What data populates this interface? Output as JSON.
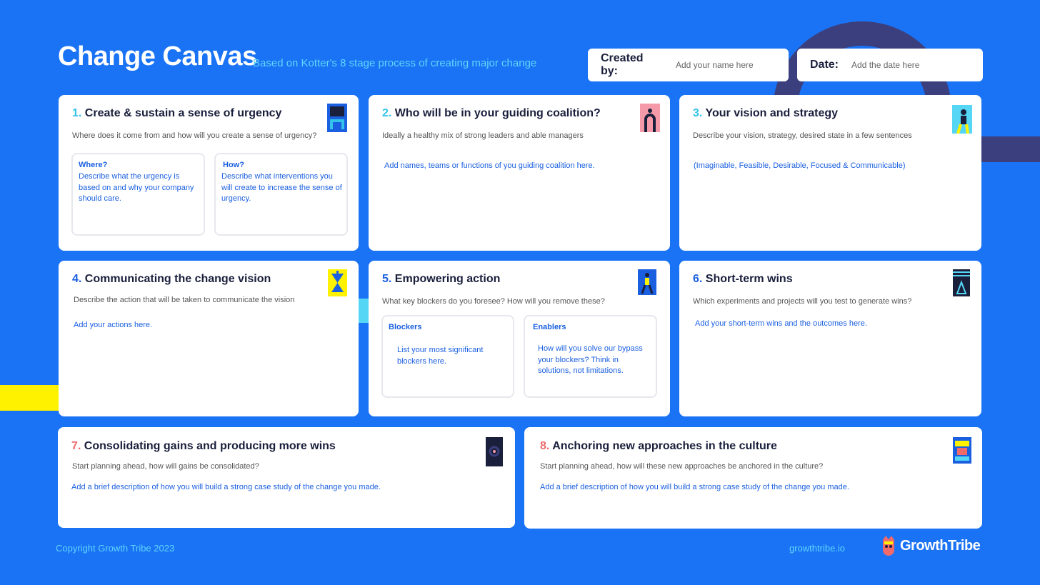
{
  "header": {
    "title": "Change Canvas",
    "subtitle": "Based on Kotter's 8 stage process of creating major change",
    "created_by_label": "Created by:",
    "created_by_placeholder": "Add your name here",
    "date_label": "Date:",
    "date_placeholder": "Add the date here"
  },
  "cards": {
    "c1": {
      "num": "1.",
      "title": "Create & sustain a sense of urgency",
      "desc": "Where does it come from and how will you create a sense of urgency?",
      "where_title": "Where?",
      "where_text": "Describe what the urgency is based on and why your company should care.",
      "how_title": "How?",
      "how_text": "Describe what interventions you will create to increase the sense of urgency."
    },
    "c2": {
      "num": "2.",
      "title": "Who will be in your guiding coalition?",
      "desc": "Ideally a healthy mix of strong leaders and able managers",
      "hint": "Add names, teams or functions of you guiding coalition here."
    },
    "c3": {
      "num": "3.",
      "title": "Your vision and strategy",
      "desc": "Describe your vision, strategy, desired state in a few sentences",
      "hint": "(Imaginable, Feasible, Desirable, Focused & Communicable)"
    },
    "c4": {
      "num": "4.",
      "title": "Communicating the change vision",
      "desc": "Describe the action that will be taken to communicate the vision",
      "hint": "Add your actions here."
    },
    "c5": {
      "num": "5.",
      "title": "Empowering action",
      "desc": "What key blockers do you foresee? How will you remove these?",
      "blockers_title": "Blockers",
      "blockers_text": "List your most significant blockers here.",
      "enablers_title": "Enablers",
      "enablers_text": "How will you solve our bypass your blockers? Think in solutions, not limitations."
    },
    "c6": {
      "num": "6.",
      "title": "Short-term wins",
      "desc": "Which experiments and projects will you test to generate wins?",
      "hint": "Add your short-term wins and the outcomes here."
    },
    "c7": {
      "num": "7.",
      "title": "Consolidating gains and producing more wins",
      "desc": "Start planning ahead, how will gains be consolidated?",
      "hint": "Add a brief description of how you will build a strong case study of the change you made."
    },
    "c8": {
      "num": "8.",
      "title": "Anchoring new approaches in the culture",
      "desc": "Start planning ahead, how will these new approaches be anchored in the culture?",
      "hint": "Add a brief description of how you will build a strong case study of the change you made."
    }
  },
  "footer": {
    "copyright": "Copyright Growth Tribe 2023",
    "url": "growthtribe.io",
    "logo_text": "GrowthTribe"
  },
  "colors": {
    "background": "#1a73f5",
    "accent_cyan": "#33c2e8",
    "accent_blue": "#1a5fe0",
    "accent_red": "#f06a6a",
    "navy": "#3b3f7d",
    "yellow": "#fff200"
  }
}
